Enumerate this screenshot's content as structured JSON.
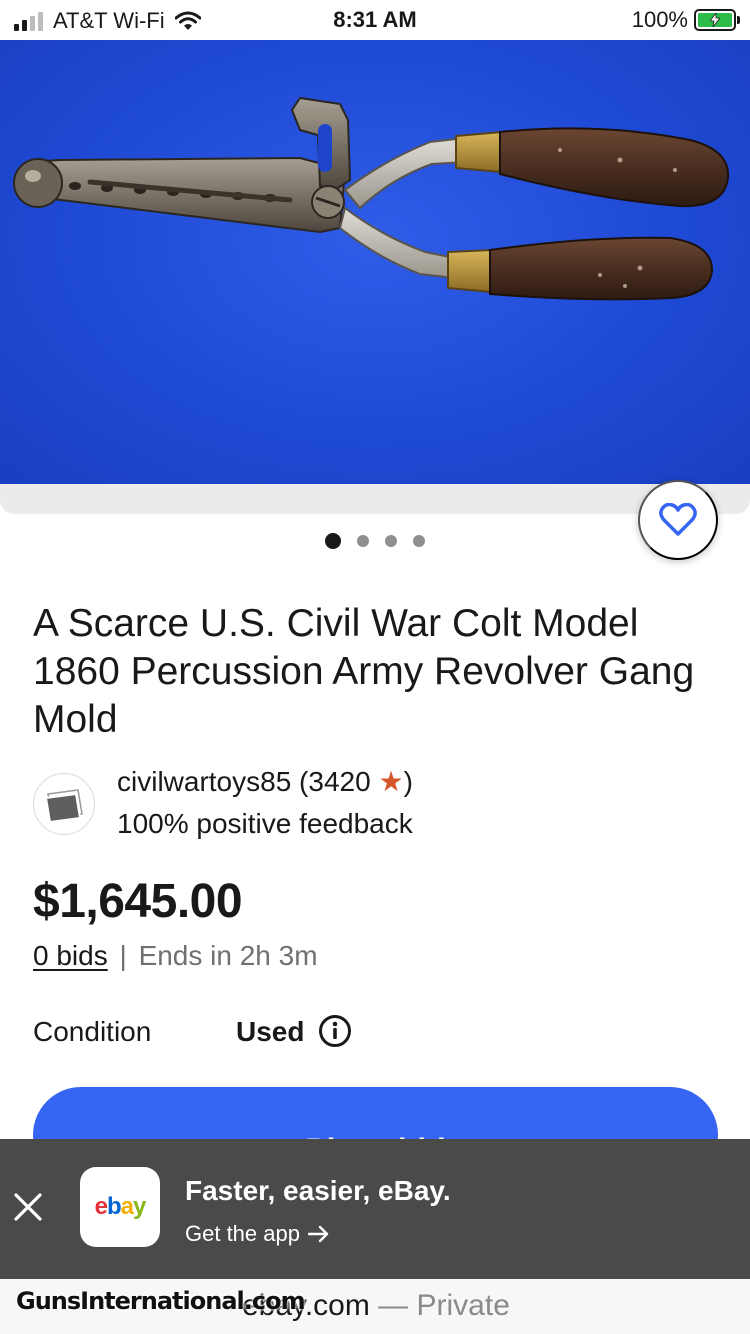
{
  "status_bar": {
    "carrier": "AT&T Wi-Fi",
    "time": "8:31 AM",
    "battery": "100%"
  },
  "gallery": {
    "image_count": 4,
    "active_index": 0
  },
  "listing": {
    "title": "A Scarce U.S. Civil War Colt Model 1860 Percussion Army Revolver Gang Mold",
    "seller_name": "civilwartoys85",
    "seller_score_open": " (3420 ",
    "seller_star": "★",
    "seller_score_close": ")",
    "seller_feedback": "100% positive feedback",
    "price": "$1,645.00",
    "bids": "0 bids",
    "bids_separator": "|",
    "ends": "Ends in 2h 3m",
    "condition_label": "Condition",
    "condition_value": "Used",
    "place_bid_label": "Place bid"
  },
  "app_banner": {
    "title": "Faster, easier, eBay.",
    "subtitle": "Get the app",
    "logo": {
      "e": "e",
      "b": "b",
      "a": "a",
      "y": "y"
    }
  },
  "url_bar": {
    "watermark": "GunsInternational.com",
    "domain": "ebay.com",
    "separator": " — ",
    "private": "Private"
  },
  "colors": {
    "accent": "#3665f3",
    "photo_background": "#2350de",
    "banner_background": "#4a4a48",
    "seller_star": "#d4572b"
  },
  "icons": {
    "wifi": "wifi-icon",
    "battery": "battery-charging-icon",
    "watch": "heart-outline-icon",
    "info": "info-circle-icon",
    "close": "close-icon",
    "arrow": "arrow-right-icon"
  }
}
